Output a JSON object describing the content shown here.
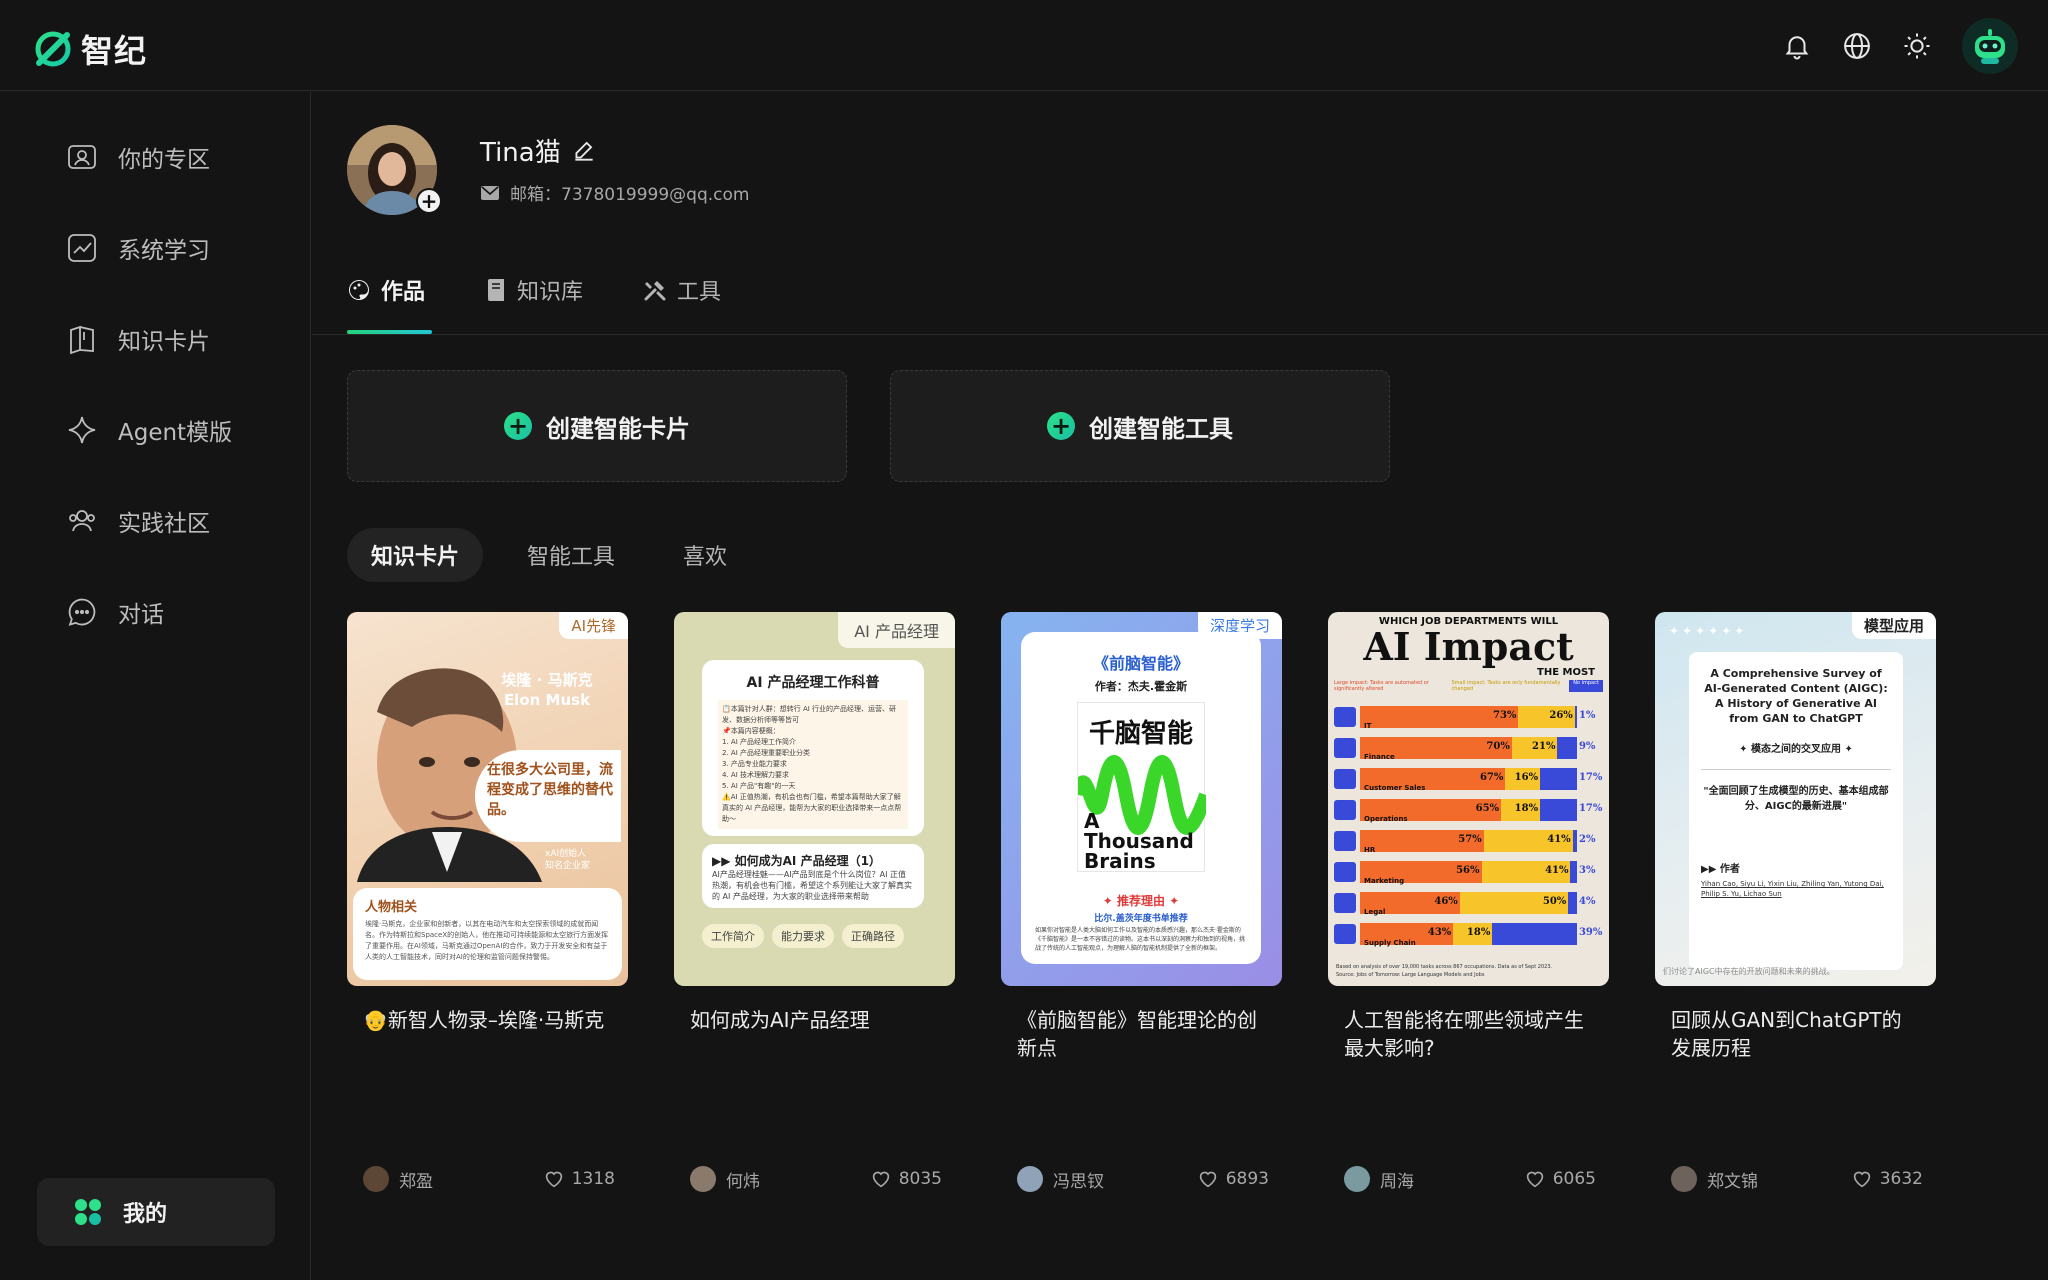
{
  "app": {
    "name": "智纪"
  },
  "sidebar": {
    "items": [
      {
        "label": "你的专区",
        "icon": "profile-card-icon"
      },
      {
        "label": "系统学习",
        "icon": "chart-line-icon"
      },
      {
        "label": "知识卡片",
        "icon": "book-open-icon"
      },
      {
        "label": "Agent模版",
        "icon": "sparkle-icon"
      },
      {
        "label": "实践社区",
        "icon": "community-icon"
      },
      {
        "label": "对话",
        "icon": "chat-bubble-icon"
      }
    ],
    "my_label": "我的"
  },
  "profile": {
    "name": "Tina猫",
    "email": "邮箱：7378019999@qq.com"
  },
  "tabs": [
    {
      "label": "作品",
      "active": true
    },
    {
      "label": "知识库",
      "active": false
    },
    {
      "label": "工具",
      "active": false
    }
  ],
  "create": {
    "card_label": "创建智能卡片",
    "tool_label": "创建智能工具"
  },
  "subtabs": [
    {
      "label": "知识卡片",
      "active": true
    },
    {
      "label": "智能工具",
      "active": false
    },
    {
      "label": "喜欢",
      "active": false
    }
  ],
  "cards": [
    {
      "badge": "AI先锋",
      "title": "👴新智人物录–埃隆·马斯克",
      "author": "郑盈",
      "likes": "1318",
      "thumb": {
        "name_cn": "埃隆 · 马斯克",
        "name_en": "Elon Musk",
        "quote": "在很多大公司里，流程变成了思维的替代品。",
        "caption": "xAI创始人\n知名企业家",
        "section": "人物相关",
        "body": "埃隆·马斯克，企业家和创新者，以其在电动汽车和太空探索领域的成就而闻名。作为特斯拉和SpaceX的创始人，他在推动可持续能源和太空旅行方面发挥了重要作用。在AI领域，马斯克通过OpenAI的合作，致力于开发安全和有益于人类的人工智能技术，同时对AI的伦理和监管问题保持警惕。"
      }
    },
    {
      "badge": "AI 产品经理",
      "title": "如何成为AI产品经理",
      "author": "何炜",
      "likes": "8035",
      "thumb": {
        "heading": "AI 产品经理工作科普",
        "intro": "📋本篇针对人群：想转行 AI 行业的产品经理、运营、研发、数据分析师等等皆可",
        "list_title": "📌本篇内容梗概：",
        "list": [
          "1. AI 产品经理工作简介",
          "2. AI 产品经理重要职业分类",
          "3. 产品专业能力要求",
          "4. AI 技术理解力要求",
          "5. AI 产品\"有趣\"的一天"
        ],
        "note": "⚠️AI 正值热潮，有机会也有门槛，希望本篇帮助大家了解真实的 AI 产品经理，能帮为大家的职业选择带来一点点帮助～",
        "sub_heading": "▶▶ 如何成为AI 产品经理（1）",
        "sub_body": "AI产品经理桂魅——AI产品到底是个什么岗位？AI 正值热潮，有机会也有门槛，希望这个系列能让大家了解真实的 AI 产品经理，为大家的职业选择带来帮助",
        "chips": [
          "工作简介",
          "能力要求",
          "正确路径"
        ]
      }
    },
    {
      "badge": "深度学习",
      "title": "《前脑智能》智能理论的创新点",
      "author": "冯思钗",
      "likes": "6893",
      "thumb": {
        "book_title": "《前脑智能》",
        "book_author": "作者：杰夫.霍金斯",
        "cover_title": "千脑智能",
        "cover_en": "A Thousand Brains",
        "reason_title": "✦ 推荐理由 ✦",
        "reason_sub": "比尔.盖茨年度书单推荐",
        "reason_body": "如果你对智能是人类大脑如何工作以及智能的本质感兴趣，那么杰夫·霍金斯的《千脑智能》是一本不容错过的读物。这本书以深刻的洞察力和独到的视角，挑战了传统的人工智能观点，为理解人脑的智能机制提供了全新的框架。"
      }
    },
    {
      "badge": "",
      "title": "人工智能将在哪些领域产生最大影响?",
      "author": "周海",
      "likes": "6065",
      "thumb": {
        "kicker": "WHICH JOB DEPARTMENTS WILL",
        "headline": "AI Impact",
        "subhead": "THE MOST",
        "legend": [
          "Large impact: Tasks are automated or significantly altered",
          "Small impact: Tasks are only fundamentally changed",
          "No impact"
        ],
        "rows": [
          {
            "label": "IT",
            "large": "73%",
            "small": "26%",
            "none": "1%"
          },
          {
            "label": "Finance",
            "large": "70%",
            "small": "21%",
            "none": "9%"
          },
          {
            "label": "Customer Sales",
            "large": "67%",
            "small": "16%",
            "none": "17%"
          },
          {
            "label": "Operations",
            "large": "65%",
            "small": "18%",
            "none": "17%"
          },
          {
            "label": "HR",
            "large": "57%",
            "small": "41%",
            "none": "2%"
          },
          {
            "label": "Marketing",
            "large": "56%",
            "small": "41%",
            "none": "3%"
          },
          {
            "label": "Legal",
            "large": "46%",
            "small": "50%",
            "none": "4%"
          },
          {
            "label": "Supply Chain",
            "large": "43%",
            "small": "18%",
            "none": "39%"
          }
        ],
        "footnote": "Based on analysis of over 19,000 tasks across 867 occupations. Data as of Sept 2023.",
        "source": "Source: Jobs of Tomorrow: Large Language Models and Jobs"
      }
    },
    {
      "badge": "模型应用",
      "title": "回顾从GAN到ChatGPT的发展历程",
      "author": "郑文锦",
      "likes": "3632",
      "thumb": {
        "paper_title": "A Comprehensive Survey of AI-Generated Content (AIGC): A History of Generative AI from GAN to ChatGPT",
        "tag": "✦ 模态之间的交叉应用 ✦",
        "quote": "\"全面回顾了生成模型的历史、基本组成部分、AIGC的最新进展\"",
        "authors_title": "▶▶ 作者",
        "authors": "Yihan Cao, Siyu Li, Yixin Liu, Zhiling Yan, Yutong Dai, Philip S. Yu, Lichao Sun",
        "footer_text": "们讨论了AIGC中存在的开放问题和未来的挑战。"
      }
    }
  ]
}
